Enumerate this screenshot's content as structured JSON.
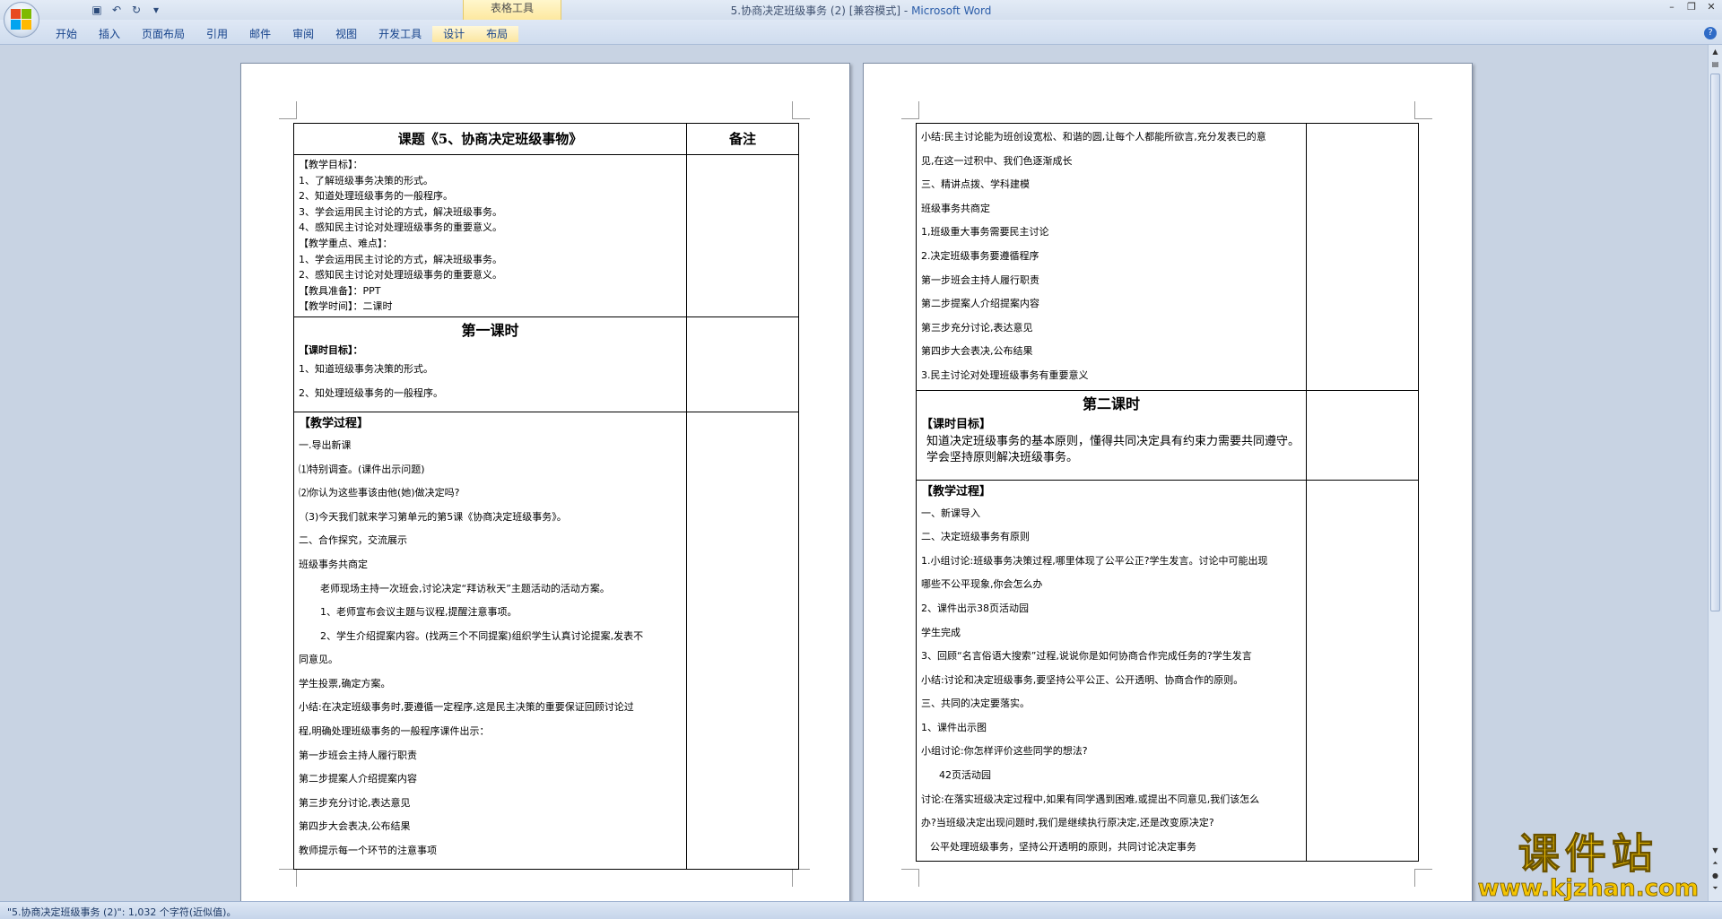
{
  "window": {
    "title_doc": "5.协商决定班级事务 (2) [兼容模式] - ",
    "title_app": "Microsoft Word",
    "contextual_group": "表格工具",
    "controls": [
      "–",
      "❐",
      "✕"
    ]
  },
  "quick_access": {
    "icons": [
      "save-icon",
      "undo-icon",
      "redo-icon",
      "customize-icon"
    ]
  },
  "ribbon": {
    "tabs": [
      "开始",
      "插入",
      "页面布局",
      "引用",
      "邮件",
      "审阅",
      "视图",
      "开发工具",
      "设计",
      "布局"
    ]
  },
  "page1": {
    "title": "课题《5、协商决定班级事物》",
    "notes_header": "备注",
    "objectives": [
      "【教学目标】：",
      "1、了解班级事务决策的形式。",
      "2、知道处理班级事务的一般程序。",
      "3、学会运用民主讨论的方式，解决班级事务。",
      "4、感知民主讨论对处理班级事务的重要意义。",
      "【教学重点、难点】：",
      "1、学会运用民主讨论的方式，解决班级事务。",
      "2、感知民主讨论对处理班级事务的重要意义。",
      "【教具准备】：PPT",
      "【教学时间】：二课时"
    ],
    "lesson1_title": "第一课时",
    "lesson1_goals": [
      "【课时目标】：",
      "1、知道班级事务决策的形式。",
      "2、知处理班级事务的一般程序。"
    ],
    "process_title": "【教学过程】",
    "process": [
      "一.导出新课",
      "⑴特别调查。(课件出示问题)",
      "⑵你认为这些事该由他(她)做决定吗?",
      "（3)今天我们就来学习第单元的第5课《协商决定班级事务》。",
      "二、合作探究，交流展示",
      "班级事务共商定",
      "老师现场主持一次班会,讨论决定“拜访秋天”主题活动的活动方案。",
      "1、老师宣布会议主题与议程,提醒注意事项。",
      "2、学生介绍提案内容。(找两三个不同提案)组织学生认真讨论提案,发表不",
      "同意见。",
      "学生投票,确定方案。",
      "小结:在决定班级事务时,要遵循一定程序,这是民主决策的重要保证回顾讨论过",
      "程,明确处理班级事务的一般程序课件出示：",
      "第一步班会主持人履行职责",
      "第二步提案人介绍提案内容",
      "第三步充分讨论,表达意见",
      "第四步大会表决,公布结果",
      "教师提示每一个环节的注意事项"
    ]
  },
  "page2": {
    "block1": [
      "小结:民主讨论能为班创设宽松、和谐的圆,让每个人都能所欲言,充分发表已的意",
      "见,在这一过积中、我们色逐渐成长",
      "三、精讲点拨、学科建模",
      "班级事务共商定",
      "1,班级重大事务需要民主讨论",
      "2.决定班级事务要遵循程序",
      "第一步班会主持人履行职责",
      "第二步提案人介绍提案内容",
      "第三步充分讨论,表达意见",
      "第四步大会表决,公布结果",
      "3.民主讨论对处理班级事务有重要意义"
    ],
    "lesson2_title": "第二课时",
    "lesson2_goal_title": "【课时目标】",
    "lesson2_goal_text": "知道决定班级事务的基本原则，懂得共同决定具有约束力需要共同遵守。学会坚持原则解决班级事务。",
    "process_title": "【教学过程】",
    "process": [
      "一、新课导入",
      "二、决定班级事务有原则",
      "1.小组讨论:班级事务决策过程,哪里体现了公平公正?学生发言。讨论中可能出现",
      "哪些不公平现象,你会怎么办",
      "2、课件出示38页活动园",
      "学生完成",
      "3、回顾“名言俗语大搜索”过程,说说你是如何协商合作完成任务的?学生发言",
      "小结:讨论和决定班级事务,要坚持公平公正、公开透明、协商合作的原则。",
      "三、共同的决定要落实。",
      "1、课件出示图",
      "小组讨论:你怎样评价这些同学的想法?",
      "42页活动园",
      "讨论:在落实班级决定过程中,如果有同学遇到困难,或提出不同意见,我们该怎么",
      "办?当班级决定出现问题时,我们是继续执行原决定,还是改变原决定?",
      "公平处理班级事务，坚持公开透明的原则，共同讨论决定事务"
    ]
  },
  "statusbar": {
    "text": "\"5.协商决定班级事务 (2)\": 1,032 个字符(近似值)。"
  },
  "watermark": {
    "main": "课件站",
    "url": "www.kjzhan.com"
  },
  "colors": {
    "ribbon_text": "#15428b",
    "watermark": "#f4c400",
    "page_bg": "#ffffff",
    "workspace": "#c8d3e3"
  }
}
